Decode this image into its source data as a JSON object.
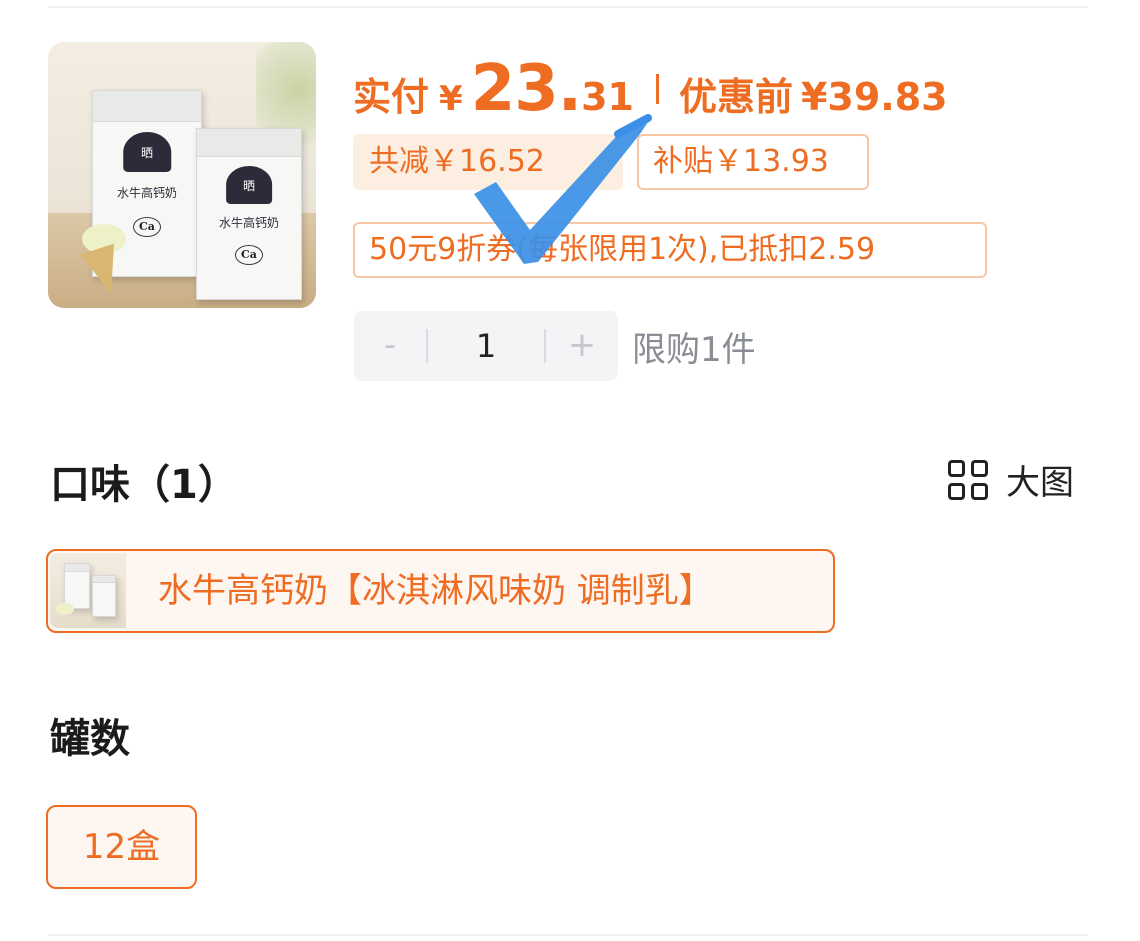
{
  "product": {
    "image_alt": "水牛高钙奶",
    "carton_brand": "晒",
    "carton_name": "水牛高钙奶",
    "carton_ca": "Ca"
  },
  "price": {
    "paid_label": "实付",
    "currency": "¥",
    "paid_int": "23.",
    "paid_dec": "31",
    "original_label": "优惠前",
    "original_value": "¥39.83"
  },
  "discounts": {
    "total_cut": "共减￥16.52",
    "subsidy": "补贴￥13.93",
    "coupon": "50元9折券(每张限用1次),已抵扣2.59"
  },
  "quantity": {
    "minus": "-",
    "value": "1",
    "plus": "+",
    "limit_text": "限购1件"
  },
  "flavor_section": {
    "title": "口味（1）",
    "big_image_label": "大图",
    "options": [
      {
        "label": "水牛高钙奶【冰淇淋风味奶 调制乳】",
        "selected": true
      }
    ]
  },
  "count_section": {
    "title": "罐数",
    "options": [
      {
        "label": "12盒",
        "selected": true
      }
    ]
  },
  "colors": {
    "accent": "#ee6d22",
    "tag_fill": "#fdeee2",
    "tag_border": "#f7c7a6",
    "check_mark": "#3b8fe6",
    "stepper_bg": "#f3f4f6"
  },
  "icons": {
    "grid": "grid-icon",
    "check": "check-mark-icon"
  }
}
